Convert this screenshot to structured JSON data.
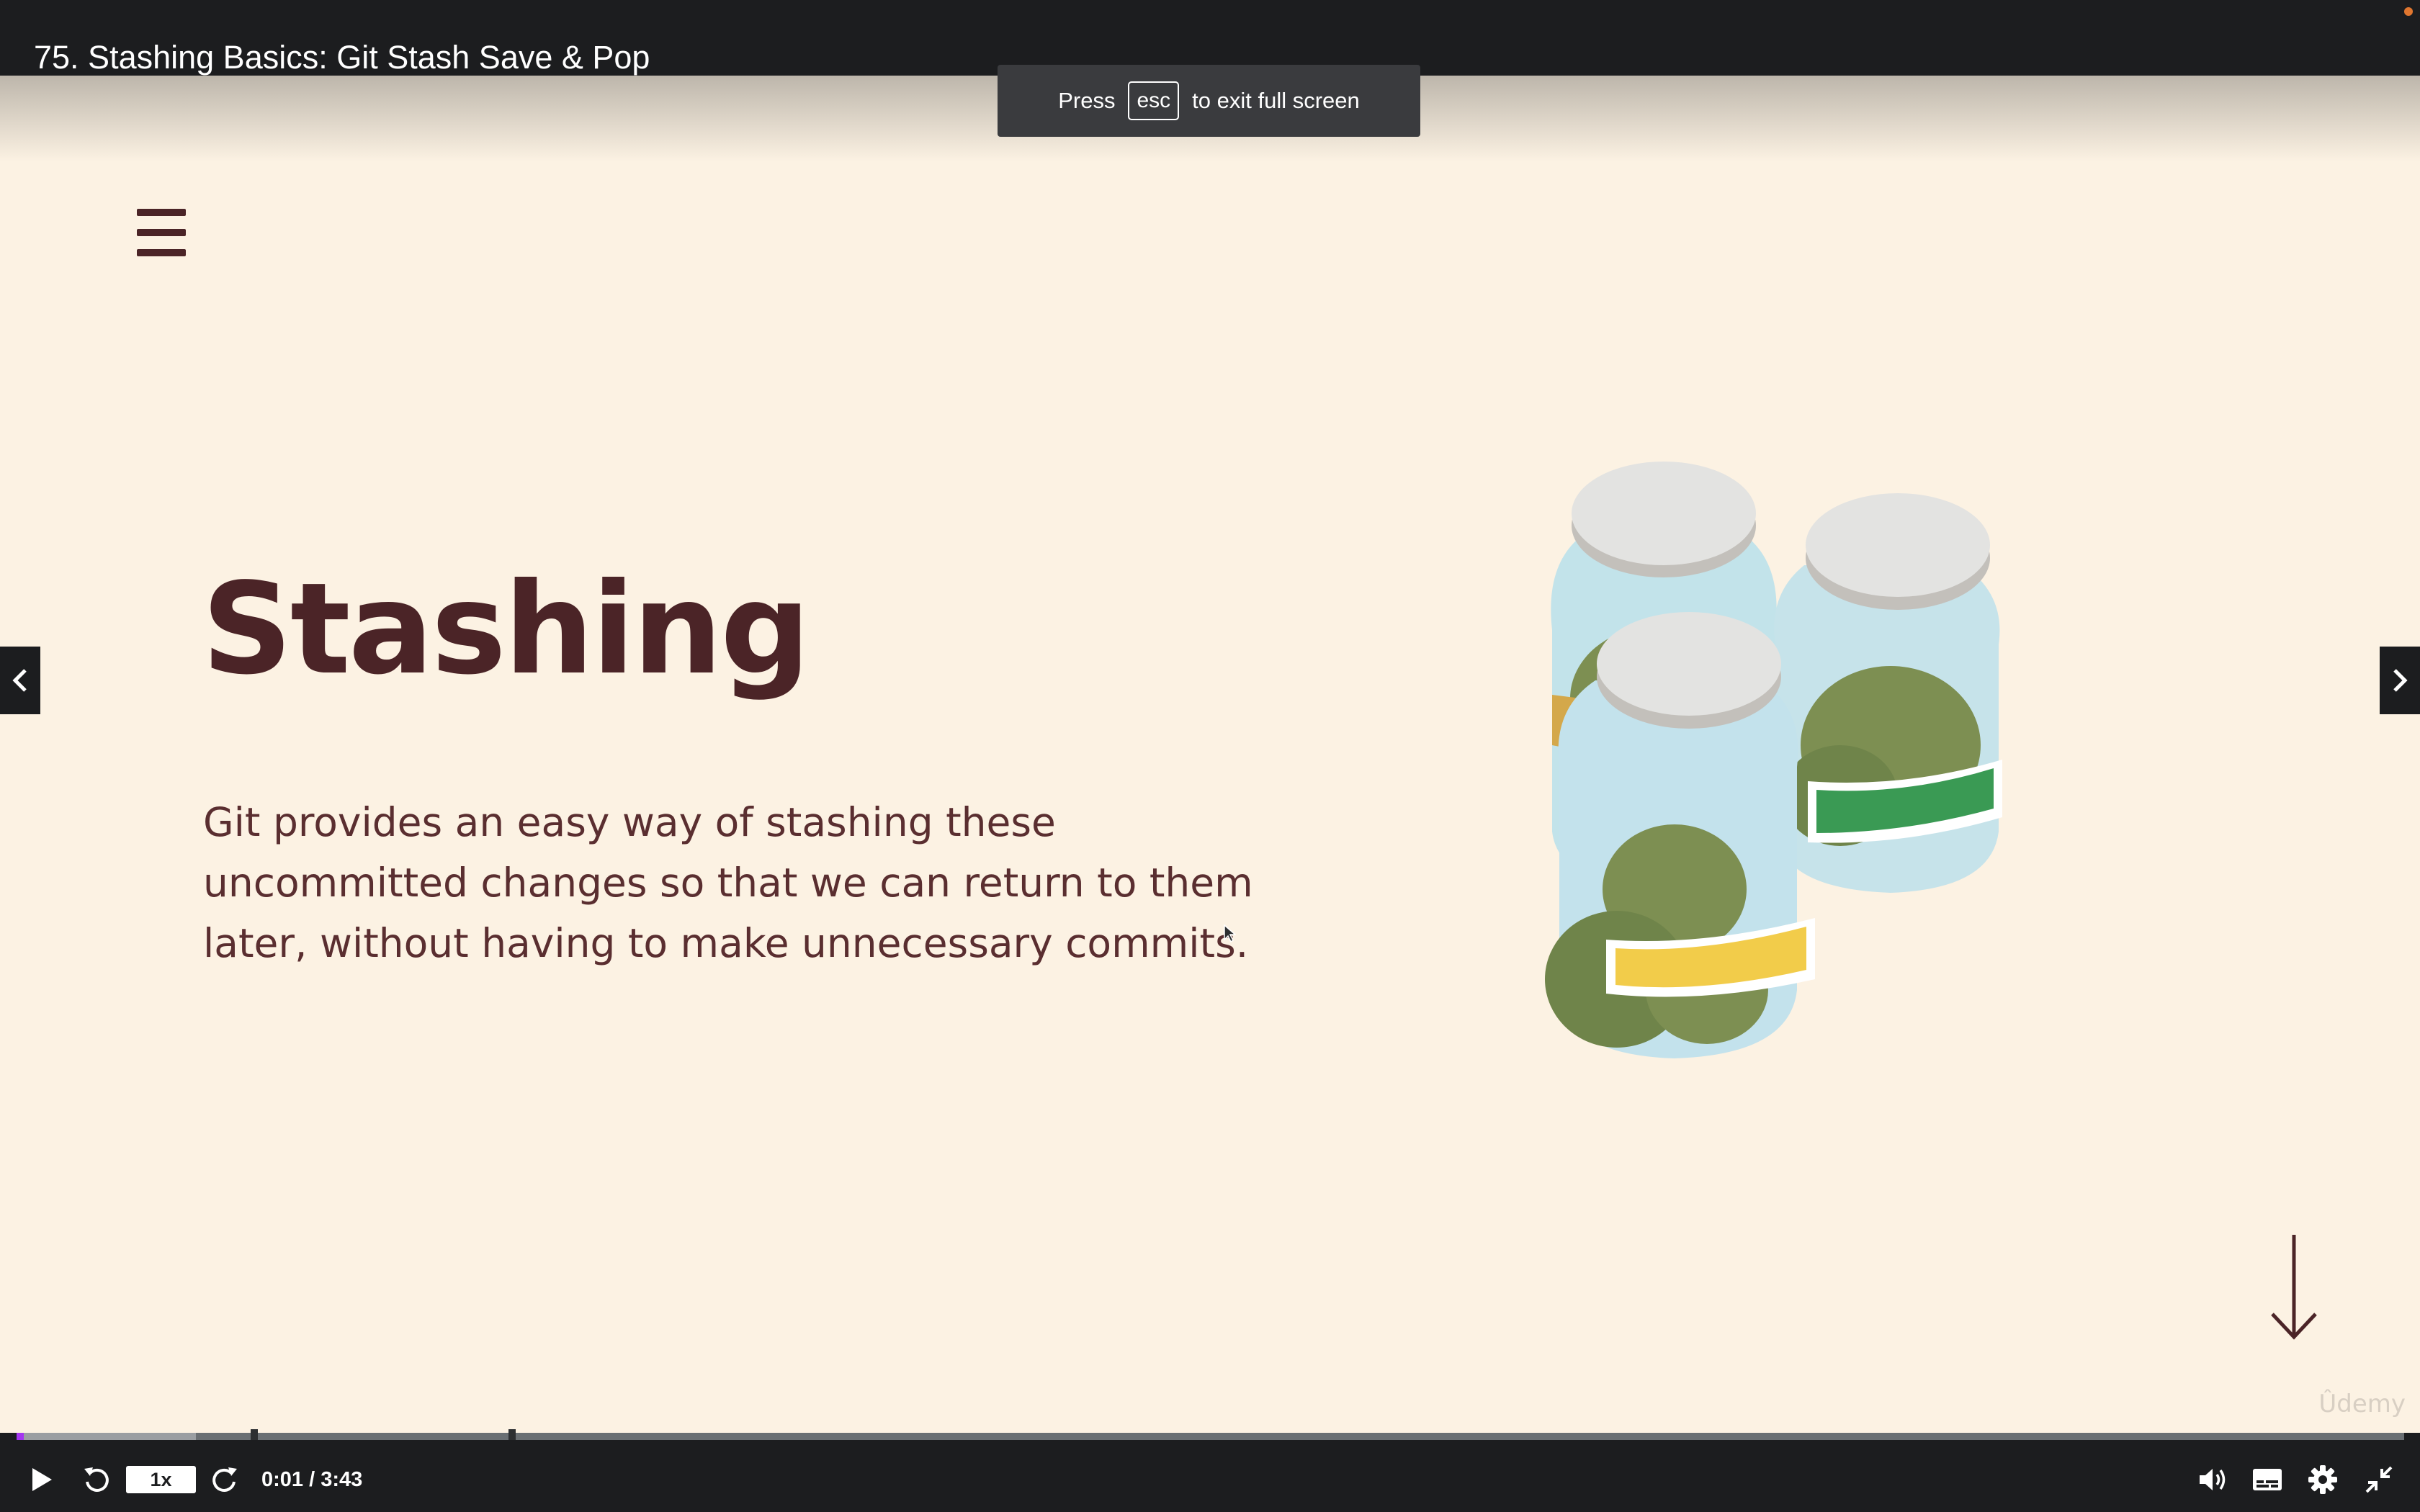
{
  "header": {
    "lecture_title": "75. Stashing Basics: Git Stash Save & Pop"
  },
  "fullscreen_notice": {
    "press": "Press",
    "key": "esc",
    "rest": "to exit full screen"
  },
  "slide": {
    "title": "Stashing",
    "body": "Git provides an easy way of stashing these uncommitted changes so that we can return to them later, without having to make unnecessary commits.",
    "illustration": "three-jars",
    "label_colors": [
      "#3a9a54",
      "#f2cc4a",
      "#d4a84a"
    ],
    "watermark": "Ûdemy"
  },
  "player": {
    "speed": "1x",
    "time": "0:01 / 3:43",
    "played_fraction": 0.003,
    "buffered_fraction": 0.075,
    "chapter_marks": [
      0.098,
      0.206
    ],
    "icons": [
      "play-icon",
      "rewind-icon",
      "forward-icon",
      "volume-icon",
      "captions-icon",
      "settings-icon",
      "exit-fullscreen-icon"
    ]
  },
  "colors": {
    "slide_bg": "#fcf2e3",
    "text": "#4b2427",
    "bar_bg": "#1c1d1f",
    "progress": "#a435f0"
  }
}
